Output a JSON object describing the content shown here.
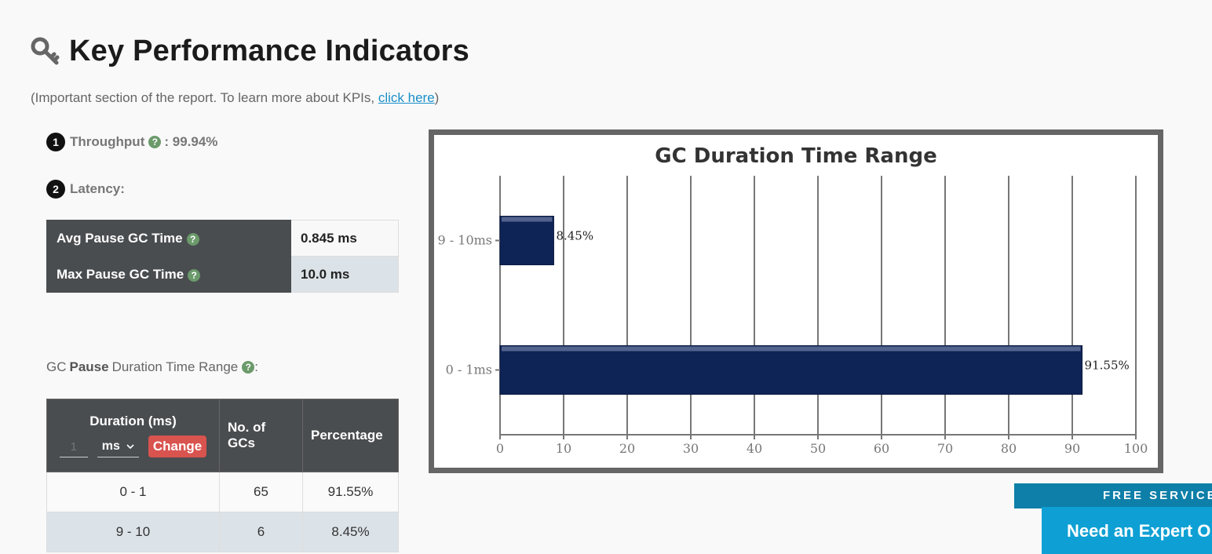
{
  "header": {
    "title": "Key Performance Indicators",
    "subtitle_prefix": "(Important section of the report. To learn more about KPIs, ",
    "subtitle_link": "click here",
    "subtitle_suffix": ")"
  },
  "kpis": {
    "throughput": {
      "num": "1",
      "label": "Throughput",
      "value": ": 99.94%"
    },
    "latency": {
      "num": "2",
      "label": "Latency:"
    }
  },
  "latency_table": [
    {
      "label": "Avg Pause GC Time",
      "value": "0.845 ms"
    },
    {
      "label": "Max Pause GC Time",
      "value": "10.0 ms"
    }
  ],
  "range_section": {
    "prefix": "GC",
    "bold": "Pause",
    "suffix": "Duration Time Range",
    "colon": ":"
  },
  "durations_table": {
    "headers": {
      "duration": "Duration (ms)",
      "count": "No. of GCs",
      "percentage": "Percentage"
    },
    "controls": {
      "input_placeholder": "1",
      "unit": "ms",
      "change_label": "Change"
    },
    "rows": [
      {
        "range": "0 - 1",
        "count": "65",
        "percentage": "91.55%"
      },
      {
        "range": "9 - 10",
        "count": "6",
        "percentage": "8.45%"
      }
    ]
  },
  "chart_data": {
    "type": "bar",
    "orientation": "horizontal",
    "title": "GC Duration Time Range",
    "categories": [
      "9 - 10ms",
      "0 - 1ms"
    ],
    "values": [
      8.45,
      91.55
    ],
    "data_labels": [
      "8.45%",
      "91.55%"
    ],
    "xlim": [
      0,
      100
    ],
    "xticks": [
      0,
      10,
      20,
      30,
      40,
      50,
      60,
      70,
      80,
      90,
      100
    ],
    "grid": "vertical",
    "bar_color": "#0f2456"
  },
  "promo": {
    "top": "FREE SERVICE",
    "main": "Need an Expert O"
  },
  "icons": {
    "title": "key-icon",
    "help": "question-circle-icon",
    "dropdown": "chevron-down-icon"
  }
}
